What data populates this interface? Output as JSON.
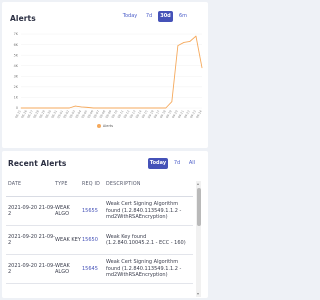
{
  "alerts": {
    "title": "Alerts",
    "ranges": [
      {
        "label": "Today",
        "active": false
      },
      {
        "label": "7d",
        "active": false
      },
      {
        "label": "30d",
        "active": true
      },
      {
        "label": "6m",
        "active": false
      }
    ],
    "legend_label": "Alerts"
  },
  "chart_data": {
    "type": "area",
    "xlabel": "",
    "ylabel": "",
    "ylim": [
      0,
      7000
    ],
    "y_ticks": [
      "0",
      "1K",
      "2K",
      "3K",
      "4K",
      "5K",
      "6K",
      "7K"
    ],
    "x": [
      "08-25",
      "08-26",
      "08-27",
      "08-28",
      "08-29",
      "08-30",
      "08-31",
      "09-01",
      "09-02",
      "09-03",
      "09-04",
      "09-05",
      "09-06",
      "09-07",
      "09-08",
      "09-09",
      "09-10",
      "09-11",
      "09-12",
      "09-13",
      "09-14",
      "09-15",
      "09-16",
      "09-17",
      "09-18",
      "09-19",
      "09-20",
      "09-21",
      "09-22",
      "09-23",
      "09-24"
    ],
    "series": [
      {
        "name": "Alerts",
        "color": "#f5a95c",
        "values": [
          0,
          0,
          0,
          0,
          0,
          0,
          0,
          0,
          0,
          180,
          100,
          60,
          0,
          0,
          0,
          0,
          0,
          0,
          0,
          0,
          0,
          0,
          0,
          0,
          0,
          600,
          5900,
          6200,
          6300,
          6800,
          3800
        ]
      }
    ],
    "grid": true,
    "legend_position": "bottom"
  },
  "recent": {
    "title": "Recent Alerts",
    "ranges": [
      {
        "label": "Today",
        "active": true
      },
      {
        "label": "7d",
        "active": false
      },
      {
        "label": "All",
        "active": false
      }
    ],
    "columns": {
      "date": "DATE",
      "type": "TYPE",
      "req_id": "REQ ID",
      "description": "DESCRIPTION"
    },
    "rows": [
      {
        "date": "2021-09-20 21-09-2",
        "type": "WEAK ALGO",
        "req_id": "15655",
        "description": "Weak Cert Signing Algorithm found (1.2.840.113549.1.1.2 - md2WithRSAEncryption)"
      },
      {
        "date": "2021-09-20 21-09-2",
        "type": "WEAK KEY",
        "req_id": "15650",
        "description": "Weak Key found (1.2.840.10045.2.1 - ECC - 160)"
      },
      {
        "date": "2021-09-20 21-09-2",
        "type": "WEAK ALGO",
        "req_id": "15645",
        "description": "Weak Cert Signing Algorithm found (1.2.840.113549.1.1.2 - md2WithRSAEncryption)"
      }
    ]
  }
}
